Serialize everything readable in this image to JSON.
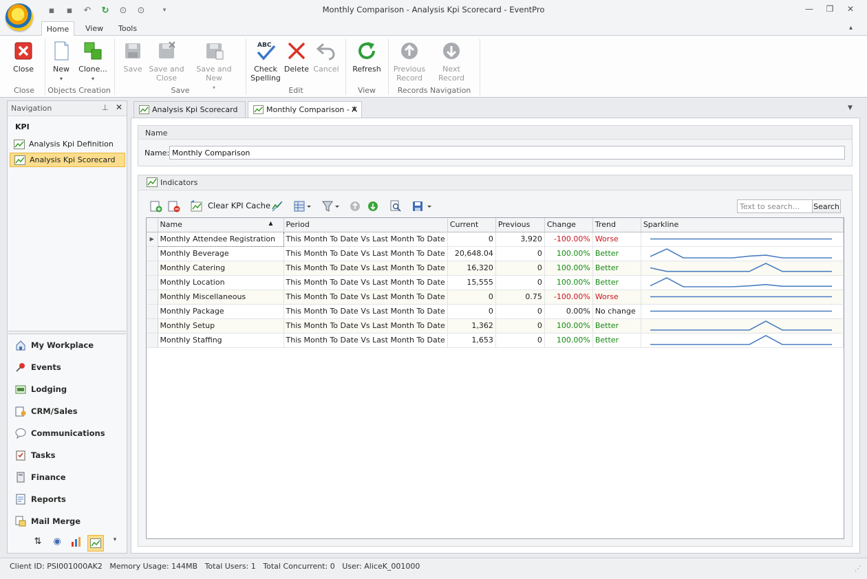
{
  "window": {
    "title": "Monthly Comparison - Analysis Kpi Scorecard - EventPro"
  },
  "ribbon": {
    "tabs": [
      "Home",
      "View",
      "Tools"
    ],
    "buttons": {
      "close": "Close",
      "new": "New",
      "clone": "Clone...",
      "save": "Save",
      "save_close_1": "Save and",
      "save_close_2": "Close",
      "save_new": "Save and New",
      "check_1": "Check",
      "check_2": "Spelling",
      "check_abc": "ABC",
      "delete": "Delete",
      "cancel": "Cancel",
      "refresh": "Refresh",
      "prev_1": "Previous",
      "prev_2": "Record",
      "next": "Next Record"
    },
    "groups": {
      "close": "Close",
      "objects": "Objects Creation",
      "save": "Save",
      "edit": "Edit",
      "view": "View",
      "records": "Records Navigation"
    }
  },
  "navigation": {
    "title": "Navigation",
    "section": "KPI",
    "items": [
      "Analysis Kpi Definition",
      "Analysis Kpi Scorecard"
    ],
    "modules": [
      "My Workplace",
      "Events",
      "Lodging",
      "CRM/Sales",
      "Communications",
      "Tasks",
      "Finance",
      "Reports",
      "Mail Merge"
    ]
  },
  "doc_tabs": [
    "Analysis Kpi Scorecard",
    "Monthly Comparison - A"
  ],
  "name_group": {
    "title": "Name",
    "label": "Name:",
    "value": "Monthly Comparison"
  },
  "indicators": {
    "title": "Indicators",
    "clear_cache": "Clear KPI Cache",
    "search_placeholder": "Text to search...",
    "search_button": "Search",
    "columns": [
      "Name",
      "Period",
      "Current",
      "Previous",
      "Change",
      "Trend",
      "Sparkline"
    ],
    "rows": [
      {
        "name": "Monthly Attendee Registration",
        "period": "This Month To Date Vs Last Month To Date",
        "current": "0",
        "previous": "3,920",
        "change": "-100.00%",
        "trend": "Worse",
        "spark": [
          0.5,
          0.5,
          0.5,
          0.5,
          0.5,
          0.5,
          0.5,
          0.5,
          0.5,
          0.5,
          0.5,
          0.5
        ]
      },
      {
        "name": "Monthly Beverage",
        "period": "This Month To Date Vs Last Month To Date",
        "current": "20,648.04",
        "previous": "0",
        "change": "100.00%",
        "trend": "Better",
        "spark": [
          0.15,
          1,
          0,
          0,
          0,
          0,
          0.2,
          0.3,
          0,
          0,
          0,
          0
        ]
      },
      {
        "name": "Monthly Catering",
        "period": "This Month To Date Vs Last Month To Date",
        "current": "16,320",
        "previous": "0",
        "change": "100.00%",
        "trend": "Better",
        "spark": [
          0.5,
          0.1,
          0.1,
          0.1,
          0.1,
          0.1,
          0.1,
          1,
          0.1,
          0.1,
          0.1,
          0.1
        ]
      },
      {
        "name": "Monthly Location",
        "period": "This Month To Date Vs Last Month To Date",
        "current": "15,555",
        "previous": "0",
        "change": "100.00%",
        "trend": "Better",
        "spark": [
          0.1,
          1,
          0,
          0,
          0,
          0,
          0.1,
          0.25,
          0.05,
          0.05,
          0.05,
          0.05
        ]
      },
      {
        "name": "Monthly Miscellaneous",
        "period": "This Month To Date Vs Last Month To Date",
        "current": "0",
        "previous": "0.75",
        "change": "-100.00%",
        "trend": "Worse",
        "spark": [
          0.5,
          0.5,
          0.5,
          0.5,
          0.5,
          0.5,
          0.5,
          0.5,
          0.5,
          0.5,
          0.5,
          0.5
        ]
      },
      {
        "name": "Monthly Package",
        "period": "This Month To Date Vs Last Month To Date",
        "current": "0",
        "previous": "0",
        "change": "0.00%",
        "trend": "No change",
        "spark": [
          0.5,
          0.5,
          0.5,
          0.5,
          0.5,
          0.5,
          0.5,
          0.5,
          0.5,
          0.5,
          0.5,
          0.5
        ]
      },
      {
        "name": "Monthly Setup",
        "period": "This Month To Date Vs Last Month To Date",
        "current": "1,362",
        "previous": "0",
        "change": "100.00%",
        "trend": "Better",
        "spark": [
          0,
          0,
          0,
          0,
          0,
          0,
          0,
          1,
          0,
          0,
          0,
          0
        ]
      },
      {
        "name": "Monthly Staffing",
        "period": "This Month To Date Vs Last Month To Date",
        "current": "1,653",
        "previous": "0",
        "change": "100.00%",
        "trend": "Better",
        "spark": [
          0,
          0,
          0,
          0,
          0,
          0,
          0,
          1,
          0,
          0,
          0,
          0
        ]
      }
    ]
  },
  "statusbar": {
    "text": "Client ID: PSI001000AK2   Memory Usage: 144MB   Total Users: 1   Total Concurrent: 0   User: AliceK_001000"
  },
  "colors": {
    "positive": "#148a14",
    "negative": "#c8141e",
    "selected_nav": "#fbdd8c",
    "sparkline": "#4a7ec0"
  }
}
